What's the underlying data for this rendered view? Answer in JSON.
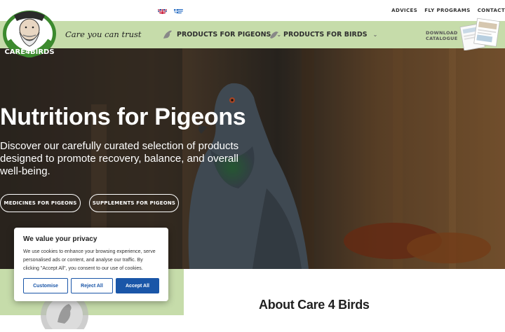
{
  "header": {
    "tagline": "Care you can trust",
    "top_links": [
      "ADVICES",
      "FLY PROGRAMS",
      "CONTACT"
    ],
    "languages": [
      "en",
      "gr"
    ],
    "logo_text": "CARE 4 BIRDS"
  },
  "nav": {
    "pigeons": "PRODUCTS FOR PIGEONS",
    "birds": "PRODUCTS FOR BIRDS",
    "catalogue_line1": "DOWNLOAD",
    "catalogue_line2": "CATALOGUE"
  },
  "hero": {
    "title": "Nutritions for Pigeons",
    "subtitle": "Discover our carefully curated selection of products designed to promote recovery, balance, and overall well-being.",
    "btn_medicines": "MEDICINES FOR PIGEONS",
    "btn_supplements": "SUPPLEMENTS FOR PIGEONS"
  },
  "about": {
    "heading": "About Care 4 Birds"
  },
  "cookie": {
    "title": "We value your privacy",
    "text": "We use cookies to enhance your browsing experience, serve personalised ads or content, and analyse our traffic. By clicking \"Accept All\", you consent to our use of cookies.",
    "customise": "Customise",
    "reject": "Reject All",
    "accept": "Accept All"
  },
  "colors": {
    "nav_green": "#c6dcaa",
    "accent_blue": "#1a56a8",
    "logo_green": "#3c8a2e"
  }
}
